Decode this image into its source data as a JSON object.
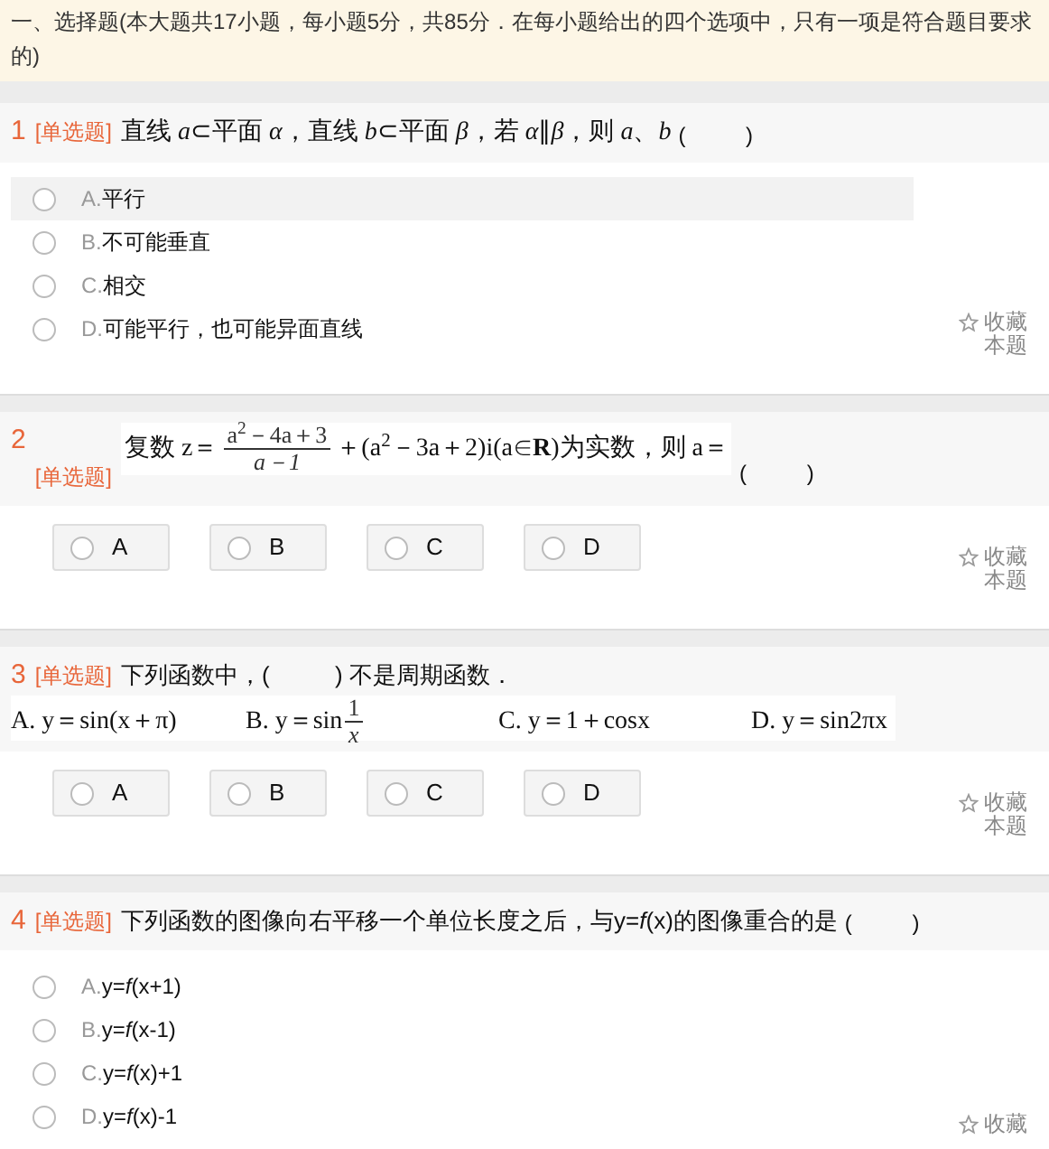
{
  "section_header": "一、选择题(本大题共17小题，每小题5分，共85分．在每小题给出的四个选项中，只有一项是符合题目要求的)",
  "questions": [
    {
      "number": "1",
      "type_tag": "[单选题]",
      "stem": [
        {
          "kind": "formula",
          "text": "直线 *a*⊂平面 *α*，直线 *b*⊂平面 *β*，若 *α*∥*β*，则 *a*、*b*"
        }
      ],
      "blank": "(          )",
      "kind": "list",
      "options": [
        {
          "letter": "A.",
          "text": "平行",
          "hovered": true,
          "selected": false
        },
        {
          "letter": "B.",
          "text": "不可能垂直",
          "hovered": false,
          "selected": false
        },
        {
          "letter": "C.",
          "text": "相交",
          "hovered": false,
          "selected": false
        },
        {
          "letter": "D.",
          "text": "可能平行，也可能异面直线",
          "hovered": false,
          "selected": false
        }
      ],
      "favorite": "收藏本题"
    },
    {
      "number": "2",
      "type_tag": "[单选题]",
      "stem": [
        {
          "kind": "formula",
          "text": "复数 z＝"
        },
        {
          "kind": "fraction",
          "numerator": "a$^{2}$－4a＋3",
          "denominator": "a－1"
        },
        {
          "kind": "formula",
          "text": "＋(a$^{2}$－3a＋2)i(a∈**R**)为实数，则 a＝"
        }
      ],
      "blank": "(          )",
      "kind": "buttons",
      "options": [
        {
          "letter": "A",
          "selected": false
        },
        {
          "letter": "B",
          "selected": false
        },
        {
          "letter": "C",
          "selected": false
        },
        {
          "letter": "D",
          "selected": false
        }
      ],
      "favorite": "收藏本题"
    },
    {
      "number": "3",
      "type_tag": "[单选题]",
      "stem": [
        {
          "kind": "text",
          "text": "下列函数中，(          ) 不是周期函数．"
        }
      ],
      "choices_line": [
        [
          {
            "kind": "formula",
            "text": "A. y＝sin(x＋π)"
          }
        ],
        [
          {
            "kind": "formula",
            "text": "B. y＝sin "
          },
          {
            "kind": "fraction",
            "numerator": "1",
            "denominator": "x"
          }
        ],
        [
          {
            "kind": "formula",
            "text": "C. y＝1＋cosx"
          }
        ],
        [
          {
            "kind": "formula",
            "text": "D. y＝sin2πx"
          }
        ]
      ],
      "kind": "buttons",
      "options": [
        {
          "letter": "A",
          "selected": false
        },
        {
          "letter": "B",
          "selected": false
        },
        {
          "letter": "C",
          "selected": false
        },
        {
          "letter": "D",
          "selected": false
        }
      ],
      "favorite": "收藏本题"
    },
    {
      "number": "4",
      "type_tag": "[单选题]",
      "stem": [
        {
          "kind": "text",
          "text": "下列函数的图像向右平移一个单位长度之后，与y=*f*(x)的图像重合的是"
        }
      ],
      "blank": "(          )",
      "kind": "list",
      "options": [
        {
          "letter": "A.",
          "text": "y=*f*(x+1)",
          "hovered": false,
          "selected": false
        },
        {
          "letter": "B.",
          "text": "y=*f*(x-1)",
          "hovered": false,
          "selected": false
        },
        {
          "letter": "C.",
          "text": "y=*f*(x)+1",
          "hovered": false,
          "selected": false
        },
        {
          "letter": "D.",
          "text": "y=*f*(x)-1",
          "hovered": false,
          "selected": false
        }
      ],
      "favorite": "收藏"
    }
  ]
}
